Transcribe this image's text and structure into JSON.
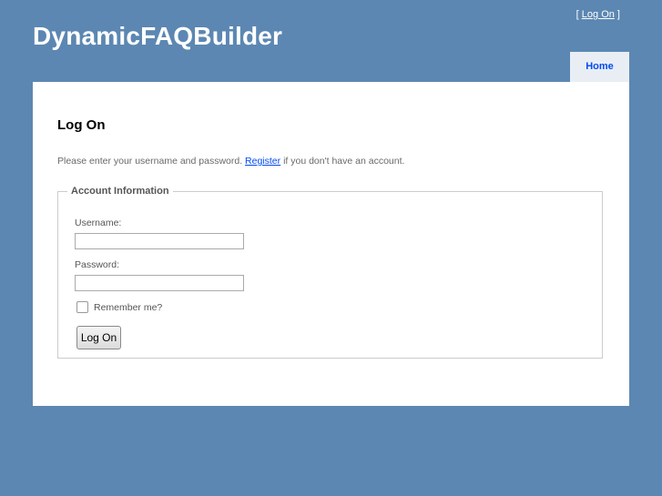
{
  "header": {
    "site_title": "DynamicFAQBuilder",
    "login_prefix": "[ ",
    "login_link": "Log On",
    "login_suffix": " ]"
  },
  "menu": {
    "items": [
      {
        "label": "Home",
        "active": true
      }
    ]
  },
  "main": {
    "heading": "Log On",
    "intro_before": "Please enter your username and password. ",
    "register_link": "Register",
    "intro_after": " if you don't have an account."
  },
  "form": {
    "legend": "Account Information",
    "username_label": "Username:",
    "username_value": "",
    "password_label": "Password:",
    "password_value": "",
    "remember_label": "Remember me?",
    "remember_checked": false,
    "submit_label": "Log On"
  },
  "colors": {
    "background": "#5c87b2",
    "content": "#ffffff",
    "tab_active": "#e8eef4",
    "link": "#034af3"
  }
}
